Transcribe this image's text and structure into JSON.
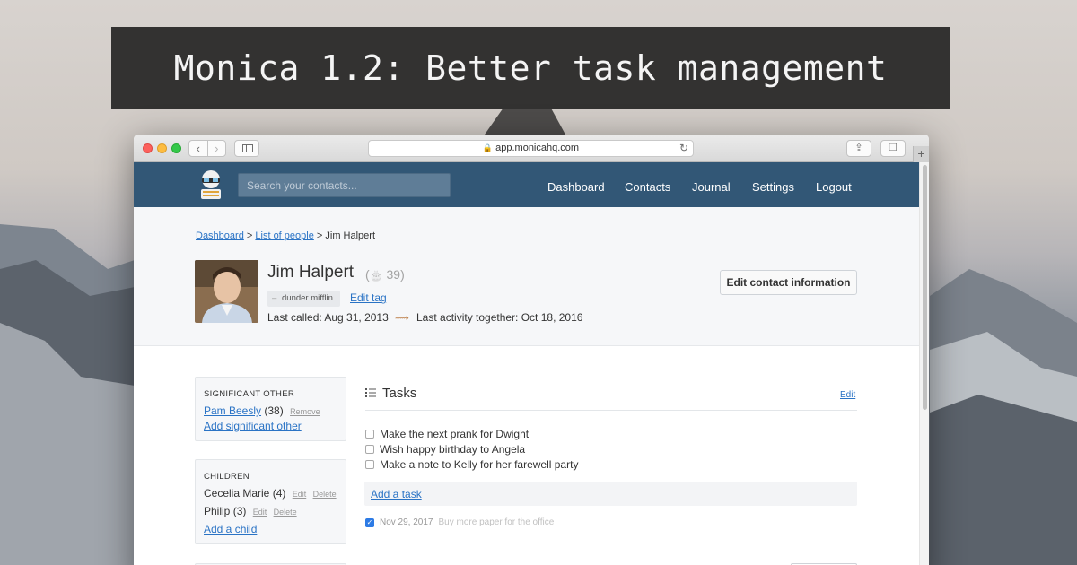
{
  "banner": {
    "title": "Monica 1.2: Better task management"
  },
  "browser": {
    "url": "app.monicahq.com",
    "icons": {
      "back": "chevron-left-icon",
      "forward": "chevron-right-icon",
      "sidebar": "sidebar-icon",
      "reload": "reload-icon",
      "share": "share-icon",
      "tabs": "tabs-icon",
      "new_tab": "plus-icon"
    },
    "back_glyph": "‹",
    "forward_glyph": "›",
    "reload_glyph": "↻",
    "share_glyph": "⇪",
    "tabs_glyph": "❐",
    "newtab_glyph": "+",
    "lock_glyph": "🔒"
  },
  "app": {
    "search_placeholder": "Search your contacts...",
    "menu": [
      "Dashboard",
      "Contacts",
      "Journal",
      "Settings",
      "Logout"
    ],
    "accent_color": "#325776",
    "link_color": "#2a73c5"
  },
  "breadcrumb": {
    "dashboard": "Dashboard",
    "sep1": ">",
    "list": "List of people",
    "sep2": ">",
    "current": "Jim Halpert"
  },
  "contact": {
    "name": "Jim Halpert",
    "age_icon": "🎂",
    "age_text": "39)",
    "age_open": "(",
    "tag": "dunder mifflin",
    "edit_tag": "Edit tag",
    "last_called": "Last called: Aug 31, 2013",
    "last_activity": "Last activity together: Oct 18, 2016",
    "edit_button": "Edit contact information"
  },
  "significant_other": {
    "heading": "SIGNIFICANT OTHER",
    "name": "Pam Beesly",
    "age": "(38)",
    "remove": "Remove",
    "add": "Add significant other"
  },
  "children": {
    "heading": "CHILDREN",
    "items": [
      {
        "name": "Cecelia Marie",
        "age": "(4)",
        "edit": "Edit",
        "delete": "Delete"
      },
      {
        "name": "Philip",
        "age": "(3)",
        "edit": "Edit",
        "delete": "Delete"
      }
    ],
    "add": "Add a child"
  },
  "tasks": {
    "title": "Tasks",
    "edit": "Edit",
    "open": [
      "Make the next prank for Dwight",
      "Wish happy birthday to Angela",
      "Make a note to Kelly for her farewell party"
    ],
    "add": "Add a task",
    "completed": {
      "date": "Nov 29, 2017",
      "description": "Buy more paper for the office"
    }
  }
}
